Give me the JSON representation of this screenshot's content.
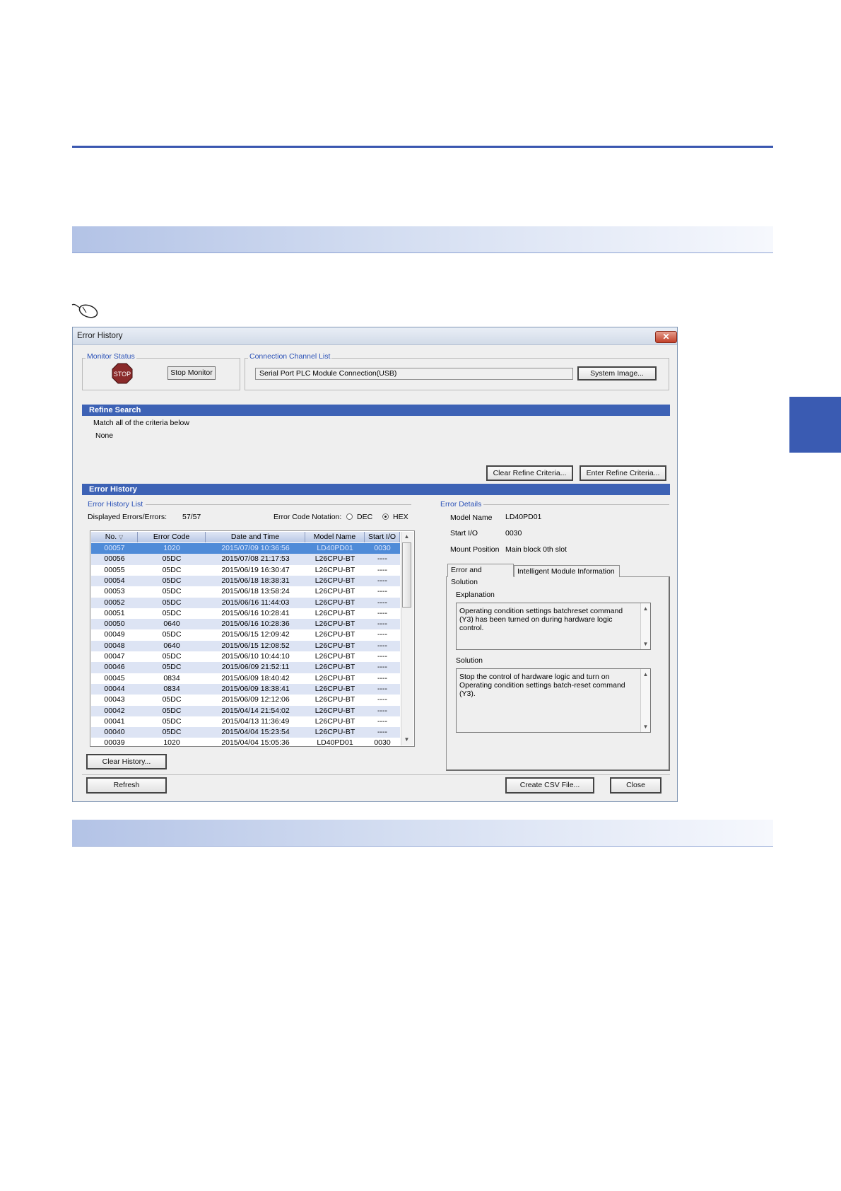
{
  "dialog": {
    "title": "Error History",
    "close_label": "✕",
    "monitor_status": {
      "legend": "Monitor Status",
      "stop_icon_text": "STOP",
      "stop_monitor_label": "Stop Monitor"
    },
    "connection": {
      "legend": "Connection Channel List",
      "value": "Serial Port  PLC Module Connection(USB)",
      "system_image_label": "System Image..."
    },
    "refine": {
      "header": "Refine Search",
      "line1": "Match all of the criteria below",
      "line2": "None",
      "clear_label": "Clear Refine Criteria...",
      "enter_label": "Enter Refine Criteria..."
    },
    "history": {
      "header": "Error History",
      "list_legend": "Error History List",
      "displayed_label": "Displayed Errors/Errors:",
      "displayed_value": "57/57",
      "notation_label": "Error Code Notation:",
      "dec_label": "DEC",
      "hex_label": "HEX",
      "columns": [
        "No.",
        "Error Code",
        "Date and Time",
        "Model Name",
        "Start I/O"
      ],
      "rows": [
        [
          "00057",
          "1020",
          "2015/07/09 10:36:56",
          "LD40PD01",
          "0030"
        ],
        [
          "00056",
          "05DC",
          "2015/07/08 21:17:53",
          "L26CPU-BT",
          "----"
        ],
        [
          "00055",
          "05DC",
          "2015/06/19 16:30:47",
          "L26CPU-BT",
          "----"
        ],
        [
          "00054",
          "05DC",
          "2015/06/18 18:38:31",
          "L26CPU-BT",
          "----"
        ],
        [
          "00053",
          "05DC",
          "2015/06/18 13:58:24",
          "L26CPU-BT",
          "----"
        ],
        [
          "00052",
          "05DC",
          "2015/06/16 11:44:03",
          "L26CPU-BT",
          "----"
        ],
        [
          "00051",
          "05DC",
          "2015/06/16 10:28:41",
          "L26CPU-BT",
          "----"
        ],
        [
          "00050",
          "0640",
          "2015/06/16 10:28:36",
          "L26CPU-BT",
          "----"
        ],
        [
          "00049",
          "05DC",
          "2015/06/15 12:09:42",
          "L26CPU-BT",
          "----"
        ],
        [
          "00048",
          "0640",
          "2015/06/15 12:08:52",
          "L26CPU-BT",
          "----"
        ],
        [
          "00047",
          "05DC",
          "2015/06/10 10:44:10",
          "L26CPU-BT",
          "----"
        ],
        [
          "00046",
          "05DC",
          "2015/06/09 21:52:11",
          "L26CPU-BT",
          "----"
        ],
        [
          "00045",
          "0834",
          "2015/06/09 18:40:42",
          "L26CPU-BT",
          "----"
        ],
        [
          "00044",
          "0834",
          "2015/06/09 18:38:41",
          "L26CPU-BT",
          "----"
        ],
        [
          "00043",
          "05DC",
          "2015/06/09 12:12:06",
          "L26CPU-BT",
          "----"
        ],
        [
          "00042",
          "05DC",
          "2015/04/14 21:54:02",
          "L26CPU-BT",
          "----"
        ],
        [
          "00041",
          "05DC",
          "2015/04/13 11:36:49",
          "L26CPU-BT",
          "----"
        ],
        [
          "00040",
          "05DC",
          "2015/04/04 15:23:54",
          "L26CPU-BT",
          "----"
        ],
        [
          "00039",
          "1020",
          "2015/04/04 15:05:36",
          "LD40PD01",
          "0030"
        ]
      ],
      "clear_history_label": "Clear History..."
    },
    "details": {
      "legend": "Error Details",
      "model_name_label": "Model Name",
      "model_name_value": "LD40PD01",
      "start_io_label": "Start I/O",
      "start_io_value": "0030",
      "mount_label": "Mount Position",
      "mount_value": "Main block 0th slot",
      "tab1": "Error and Solution",
      "tab2": "Intelligent Module Information",
      "explanation_label": "Explanation",
      "explanation_text": "Operating condition settings batchreset command (Y3) has been turned on during hardware logic control.",
      "solution_label": "Solution",
      "solution_text": "Stop the control of hardware logic and turn on Operating condition settings batch-reset command (Y3)."
    },
    "footer": {
      "refresh_label": "Refresh",
      "csv_label": "Create CSV File...",
      "close_label": "Close"
    }
  }
}
